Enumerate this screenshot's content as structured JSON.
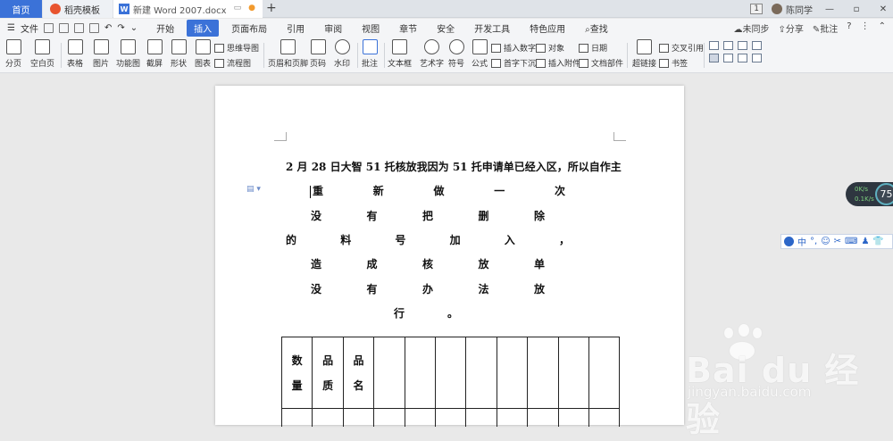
{
  "tabs": {
    "home": "首页",
    "template": "稻壳模板",
    "document": "新建 Word 2007.docx",
    "add": "+"
  },
  "window": {
    "page_badge": "1",
    "user": "陈同学",
    "minimize": "—",
    "maximize": "▫",
    "close": "✕"
  },
  "menu": {
    "file": "文件",
    "tabs": [
      "开始",
      "插入",
      "页面布局",
      "引用",
      "审阅",
      "视图",
      "章节",
      "安全",
      "开发工具",
      "特色应用"
    ],
    "active_tab": "插入",
    "search": "查找",
    "sync": "未同步",
    "share": "分享",
    "comment": "批注",
    "help": "?"
  },
  "ribbon": {
    "page_break": "分页",
    "blank_page": "空白页",
    "table": "表格",
    "picture": "图片",
    "function_chart": "功能图",
    "screenshot": "截屏",
    "shape": "形状",
    "chart": "图表",
    "mindmap": "思维导图",
    "flowchart": "流程图",
    "header_footer": "页眉和页脚",
    "page_number": "页码",
    "watermark": "水印",
    "comment": "批注",
    "textbox": "文本框",
    "wordart": "艺术字",
    "symbol": "符号",
    "formula": "公式",
    "insert_number": "插入数字",
    "object": "对象",
    "date": "日期",
    "drop_cap": "首字下沉",
    "attachment": "插入附件",
    "doc_parts": "文档部件",
    "hyperlink": "超链接",
    "cross_ref": "交叉引用",
    "bookmark": "书签"
  },
  "document": {
    "line1": "2 月 28 日大智 51 托核放我因为 51 托申请单已经入区，所以自作主",
    "line2": [
      "重",
      "新",
      "做",
      "一",
      "次"
    ],
    "line3": [
      "没",
      "有",
      "把",
      "删",
      "除"
    ],
    "line4": [
      "的",
      "料",
      "号",
      "加",
      "入",
      "，"
    ],
    "line5": [
      "造",
      "成",
      "核",
      "放",
      "单"
    ],
    "line6": [
      "没",
      "有",
      "办",
      "法",
      "放"
    ],
    "line7": [
      "行",
      "。"
    ],
    "table_headers": [
      "数量",
      "品质",
      "品名"
    ]
  },
  "widgets": {
    "speed_up": "0K/s",
    "speed_down": "0.1K/s",
    "gauge": "75",
    "ime": [
      "中",
      "°,",
      "☺",
      "✂",
      "⌨",
      "♟",
      "👕"
    ]
  },
  "watermark": {
    "brand": "Bai du 经验",
    "url": "jingyan.baidu.com"
  }
}
